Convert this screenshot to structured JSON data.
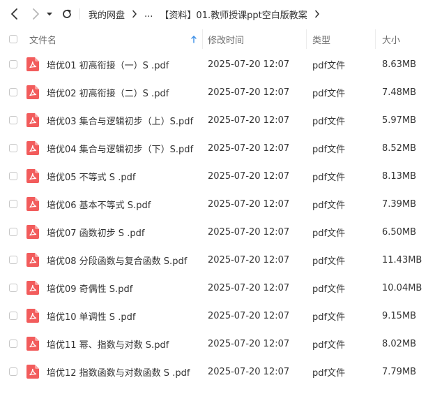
{
  "breadcrumb": {
    "root": "我的网盘",
    "ellipsis": "...",
    "current": "【资料】01.教师授课ppt空白版教案"
  },
  "columns": {
    "name": "文件名",
    "modified": "修改时间",
    "type": "类型",
    "size": "大小"
  },
  "files": [
    {
      "name": "培优01 初高衔接（一）S .pdf",
      "modified": "2025-07-20 12:07",
      "type": "pdf文件",
      "size": "8.63MB"
    },
    {
      "name": "培优02 初高衔接（二）S .pdf",
      "modified": "2025-07-20 12:07",
      "type": "pdf文件",
      "size": "7.48MB"
    },
    {
      "name": "培优03 集合与逻辑初步（上）S.pdf",
      "modified": "2025-07-20 12:07",
      "type": "pdf文件",
      "size": "5.97MB"
    },
    {
      "name": "培优04 集合与逻辑初步（下）S.pdf",
      "modified": "2025-07-20 12:07",
      "type": "pdf文件",
      "size": "8.52MB"
    },
    {
      "name": "培优05 不等式 S .pdf",
      "modified": "2025-07-20 12:07",
      "type": "pdf文件",
      "size": "8.13MB"
    },
    {
      "name": "培优06 基本不等式 S.pdf",
      "modified": "2025-07-20 12:07",
      "type": "pdf文件",
      "size": "7.39MB"
    },
    {
      "name": "培优07 函数初步 S .pdf",
      "modified": "2025-07-20 12:07",
      "type": "pdf文件",
      "size": "6.50MB"
    },
    {
      "name": "培优08 分段函数与复合函数 S.pdf",
      "modified": "2025-07-20 12:07",
      "type": "pdf文件",
      "size": "11.43MB"
    },
    {
      "name": "培优09 奇偶性 S.pdf",
      "modified": "2025-07-20 12:07",
      "type": "pdf文件",
      "size": "10.04MB"
    },
    {
      "name": "培优10 单调性 S .pdf",
      "modified": "2025-07-20 12:07",
      "type": "pdf文件",
      "size": "9.15MB"
    },
    {
      "name": "培优11 幂、指数与对数 S.pdf",
      "modified": "2025-07-20 12:07",
      "type": "pdf文件",
      "size": "8.02MB"
    },
    {
      "name": "培优12 指数函数与对数函数 S .pdf",
      "modified": "2025-07-20 12:07",
      "type": "pdf文件",
      "size": "7.79MB"
    }
  ],
  "colors": {
    "pdf_icon": "#f25c5c",
    "sort_arrow": "#3a8ee6"
  }
}
